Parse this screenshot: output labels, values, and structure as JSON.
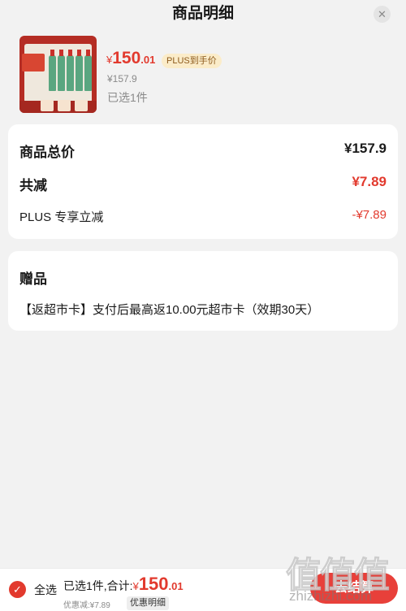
{
  "header": {
    "title": "商品明细"
  },
  "product": {
    "price_symbol": "¥",
    "price_int": "150",
    "price_dec": ".01",
    "plus_tag": "PLUS到手价",
    "original_price": "¥157.9",
    "selected_count": "已选1件"
  },
  "summary": {
    "total_label": "商品总价",
    "total_value": "¥157.9",
    "reduce_label": "共减",
    "reduce_value": "¥7.89",
    "plus_label": "PLUS 专享立减",
    "plus_value": "-¥7.89"
  },
  "gift": {
    "title": "赠品",
    "description": "【返超市卡】支付后最高返10.00元超市卡（效期30天）"
  },
  "footer": {
    "select_all": "全选",
    "summary_text": "已选1件,合计:",
    "price_symbol": "¥",
    "price_int": "150",
    "price_dec": ".01",
    "discount_text": "优惠减:¥7.89",
    "detail_link": "优惠明细",
    "checkout_label": "去结算"
  },
  "watermark": {
    "logo": "值值值",
    "url": "zhizhizhi.com"
  },
  "colors": {
    "accent": "#e23a2e",
    "plus_tag_bg": "#fbecc9",
    "plus_tag_text": "#8d5a1c",
    "background": "#f2f2f2"
  },
  "icons": {
    "close": "close-icon",
    "check": "check-icon"
  }
}
